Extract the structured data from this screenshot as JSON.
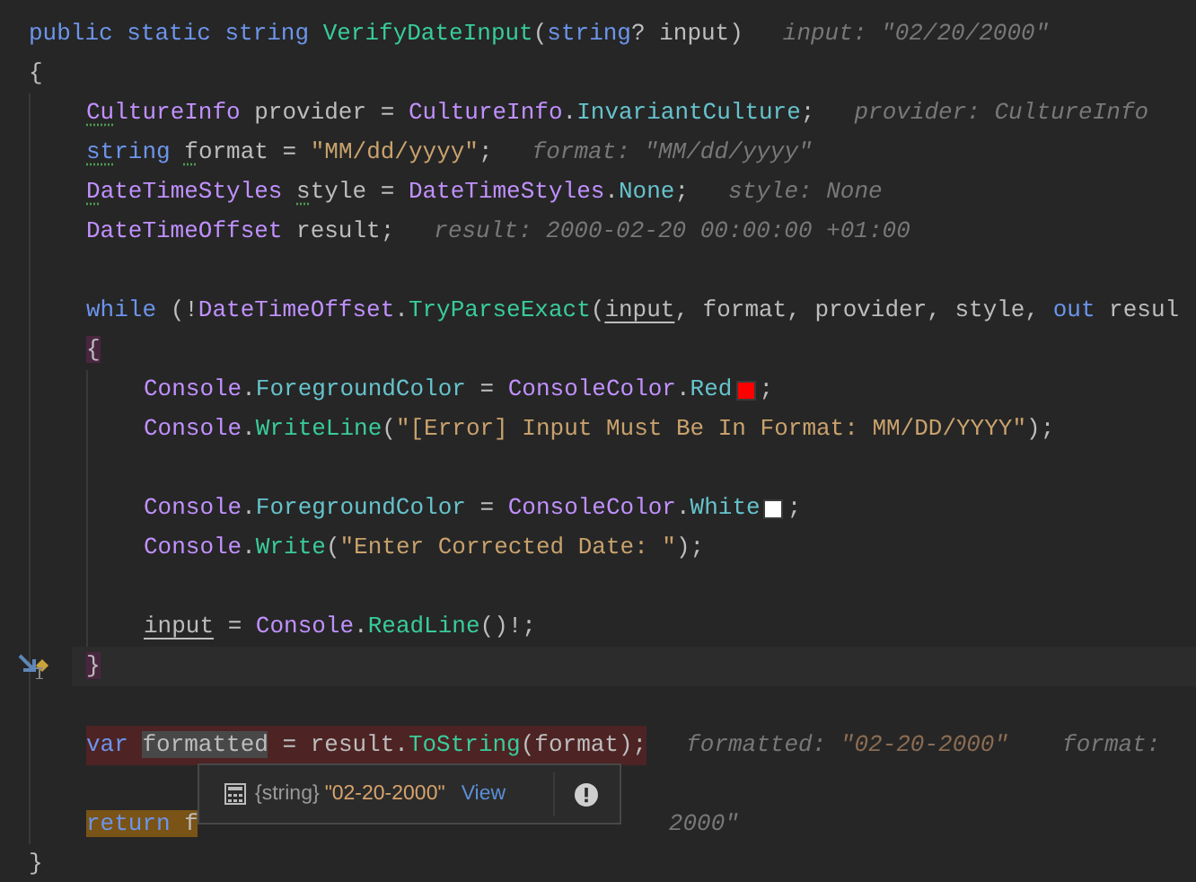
{
  "editor": {
    "lines": [
      {
        "kind": "code",
        "tokens": [
          {
            "kind": "kw",
            "text": "public static string "
          },
          {
            "kind": "method",
            "text": "VerifyDateInput"
          },
          {
            "kind": "plain",
            "text": "("
          },
          {
            "kind": "kw",
            "text": "string"
          },
          {
            "kind": "plain",
            "text": "? input)"
          },
          {
            "kind": "hint",
            "text": "input: \"02/20/2000\""
          }
        ]
      },
      {
        "kind": "code",
        "tokens": [
          {
            "kind": "plain",
            "text": "{"
          }
        ],
        "children": [
          {
            "kind": "code",
            "tokens": [
              {
                "kind": "type",
                "text": "Cu",
                "warning": true
              },
              {
                "kind": "type",
                "text": "ltureInfo"
              },
              {
                "kind": "plain",
                "text": " provider = "
              },
              {
                "kind": "type",
                "text": "CultureInfo"
              },
              {
                "kind": "plain",
                "text": "."
              },
              {
                "kind": "member",
                "text": "InvariantCulture"
              },
              {
                "kind": "plain",
                "text": ";"
              },
              {
                "kind": "hint",
                "text": "provider: CultureInfo"
              }
            ]
          },
          {
            "kind": "code",
            "tokens": [
              {
                "kind": "kw",
                "text": "st",
                "warning": true
              },
              {
                "kind": "kw",
                "text": "ring "
              },
              {
                "kind": "plain",
                "text": "f",
                "warning": true
              },
              {
                "kind": "plain",
                "text": "ormat = "
              },
              {
                "kind": "str",
                "text": "\"MM/dd/yyyy\""
              },
              {
                "kind": "plain",
                "text": ";"
              },
              {
                "kind": "hint",
                "text": "format: \"MM/dd/yyyy\""
              }
            ]
          },
          {
            "kind": "code",
            "tokens": [
              {
                "kind": "type",
                "text": "D",
                "warning": true
              },
              {
                "kind": "type",
                "text": "ateTimeStyles "
              },
              {
                "kind": "plain",
                "text": "s",
                "warning": true
              },
              {
                "kind": "plain",
                "text": "tyle = "
              },
              {
                "kind": "type",
                "text": "DateTimeStyles"
              },
              {
                "kind": "plain",
                "text": "."
              },
              {
                "kind": "member",
                "text": "None"
              },
              {
                "kind": "plain",
                "text": ";"
              },
              {
                "kind": "hint",
                "text": "style: None"
              }
            ]
          },
          {
            "kind": "code",
            "tokens": [
              {
                "kind": "type",
                "text": "DateTimeOffset"
              },
              {
                "kind": "plain",
                "text": " result;"
              },
              {
                "kind": "hint",
                "text": "result: 2000-02-20 00:00:00 +01:00"
              }
            ]
          },
          {
            "kind": "blank"
          },
          {
            "kind": "code",
            "tokens": [
              {
                "kind": "kw",
                "text": "while"
              },
              {
                "kind": "plain",
                "text": " (!"
              },
              {
                "kind": "type",
                "text": "DateTimeOffset"
              },
              {
                "kind": "plain",
                "text": "."
              },
              {
                "kind": "method",
                "text": "TryParseExact"
              },
              {
                "kind": "plain",
                "text": "("
              },
              {
                "kind": "plain",
                "text": "input",
                "underline": true
              },
              {
                "kind": "plain",
                "text": ", format, provider, style, "
              },
              {
                "kind": "kw",
                "text": "out"
              },
              {
                "kind": "plain",
                "text": " resul"
              }
            ]
          },
          {
            "kind": "code",
            "tokens": [
              {
                "kind": "plain",
                "text": "{",
                "matched": true
              }
            ],
            "children": [
              {
                "kind": "code",
                "tokens": [
                  {
                    "kind": "type",
                    "text": "Console"
                  },
                  {
                    "kind": "plain",
                    "text": "."
                  },
                  {
                    "kind": "member",
                    "text": "ForegroundColor"
                  },
                  {
                    "kind": "plain",
                    "text": " = "
                  },
                  {
                    "kind": "type",
                    "text": "ConsoleColor"
                  },
                  {
                    "kind": "plain",
                    "text": "."
                  },
                  {
                    "kind": "member",
                    "text": "Red"
                  },
                  {
                    "kind": "swatch",
                    "color": "#ff0000"
                  },
                  {
                    "kind": "plain",
                    "text": ";"
                  }
                ]
              },
              {
                "kind": "code",
                "tokens": [
                  {
                    "kind": "type",
                    "text": "Console"
                  },
                  {
                    "kind": "plain",
                    "text": "."
                  },
                  {
                    "kind": "method",
                    "text": "WriteLine"
                  },
                  {
                    "kind": "plain",
                    "text": "("
                  },
                  {
                    "kind": "str",
                    "text": "\"[Error] Input Must Be In Format: MM/DD/YYYY\""
                  },
                  {
                    "kind": "plain",
                    "text": ");"
                  }
                ]
              },
              {
                "kind": "blank"
              },
              {
                "kind": "code",
                "tokens": [
                  {
                    "kind": "type",
                    "text": "Console"
                  },
                  {
                    "kind": "plain",
                    "text": "."
                  },
                  {
                    "kind": "member",
                    "text": "ForegroundColor"
                  },
                  {
                    "kind": "plain",
                    "text": " = "
                  },
                  {
                    "kind": "type",
                    "text": "ConsoleColor"
                  },
                  {
                    "kind": "plain",
                    "text": "."
                  },
                  {
                    "kind": "member",
                    "text": "White"
                  },
                  {
                    "kind": "swatch",
                    "color": "#ffffff"
                  },
                  {
                    "kind": "plain",
                    "text": ";"
                  }
                ]
              },
              {
                "kind": "code",
                "tokens": [
                  {
                    "kind": "type",
                    "text": "Console"
                  },
                  {
                    "kind": "plain",
                    "text": "."
                  },
                  {
                    "kind": "method",
                    "text": "Write"
                  },
                  {
                    "kind": "plain",
                    "text": "("
                  },
                  {
                    "kind": "str",
                    "text": "\"Enter Corrected Date: \""
                  },
                  {
                    "kind": "plain",
                    "text": ");"
                  }
                ]
              },
              {
                "kind": "blank"
              },
              {
                "kind": "code",
                "tokens": [
                  {
                    "kind": "plain",
                    "text": "input",
                    "underline": true
                  },
                  {
                    "kind": "plain",
                    "text": " = "
                  },
                  {
                    "kind": "type",
                    "text": "Console"
                  },
                  {
                    "kind": "plain",
                    "text": "."
                  },
                  {
                    "kind": "method",
                    "text": "ReadLine"
                  },
                  {
                    "kind": "plain",
                    "text": "()!;"
                  }
                ]
              }
            ]
          },
          {
            "kind": "code",
            "tokens": [
              {
                "kind": "plain",
                "text": "}",
                "matched": true
              }
            ],
            "current": true,
            "execution_point": true
          },
          {
            "kind": "blank"
          },
          {
            "kind": "code",
            "breakpoint": true,
            "tokens": [
              {
                "kind": "kw",
                "text": "var "
              },
              {
                "kind": "plain",
                "text": "formatted",
                "selected": true
              },
              {
                "kind": "plain",
                "text": " = result."
              },
              {
                "kind": "method",
                "text": "ToString"
              },
              {
                "kind": "plain",
                "text": "(format);"
              },
              {
                "kind": "hint",
                "text": "formatted: "
              },
              {
                "kind": "hint_str",
                "text": "\"02-20-2000\""
              },
              {
                "kind": "hint",
                "text": "format:"
              }
            ]
          },
          {
            "kind": "blank"
          },
          {
            "kind": "code",
            "tokens": [
              {
                "kind": "kw",
                "text": "return",
                "marked": true
              },
              {
                "kind": "plain",
                "text": " f",
                "marked": true
              },
              {
                "kind": "hint_tail",
                "text": "2000\""
              }
            ]
          }
        ]
      },
      {
        "kind": "code",
        "tokens": [
          {
            "kind": "plain",
            "text": "}"
          }
        ]
      }
    ],
    "popup": {
      "type_label": "{string}",
      "value": "\"02-20-2000\"",
      "link": "View"
    }
  }
}
